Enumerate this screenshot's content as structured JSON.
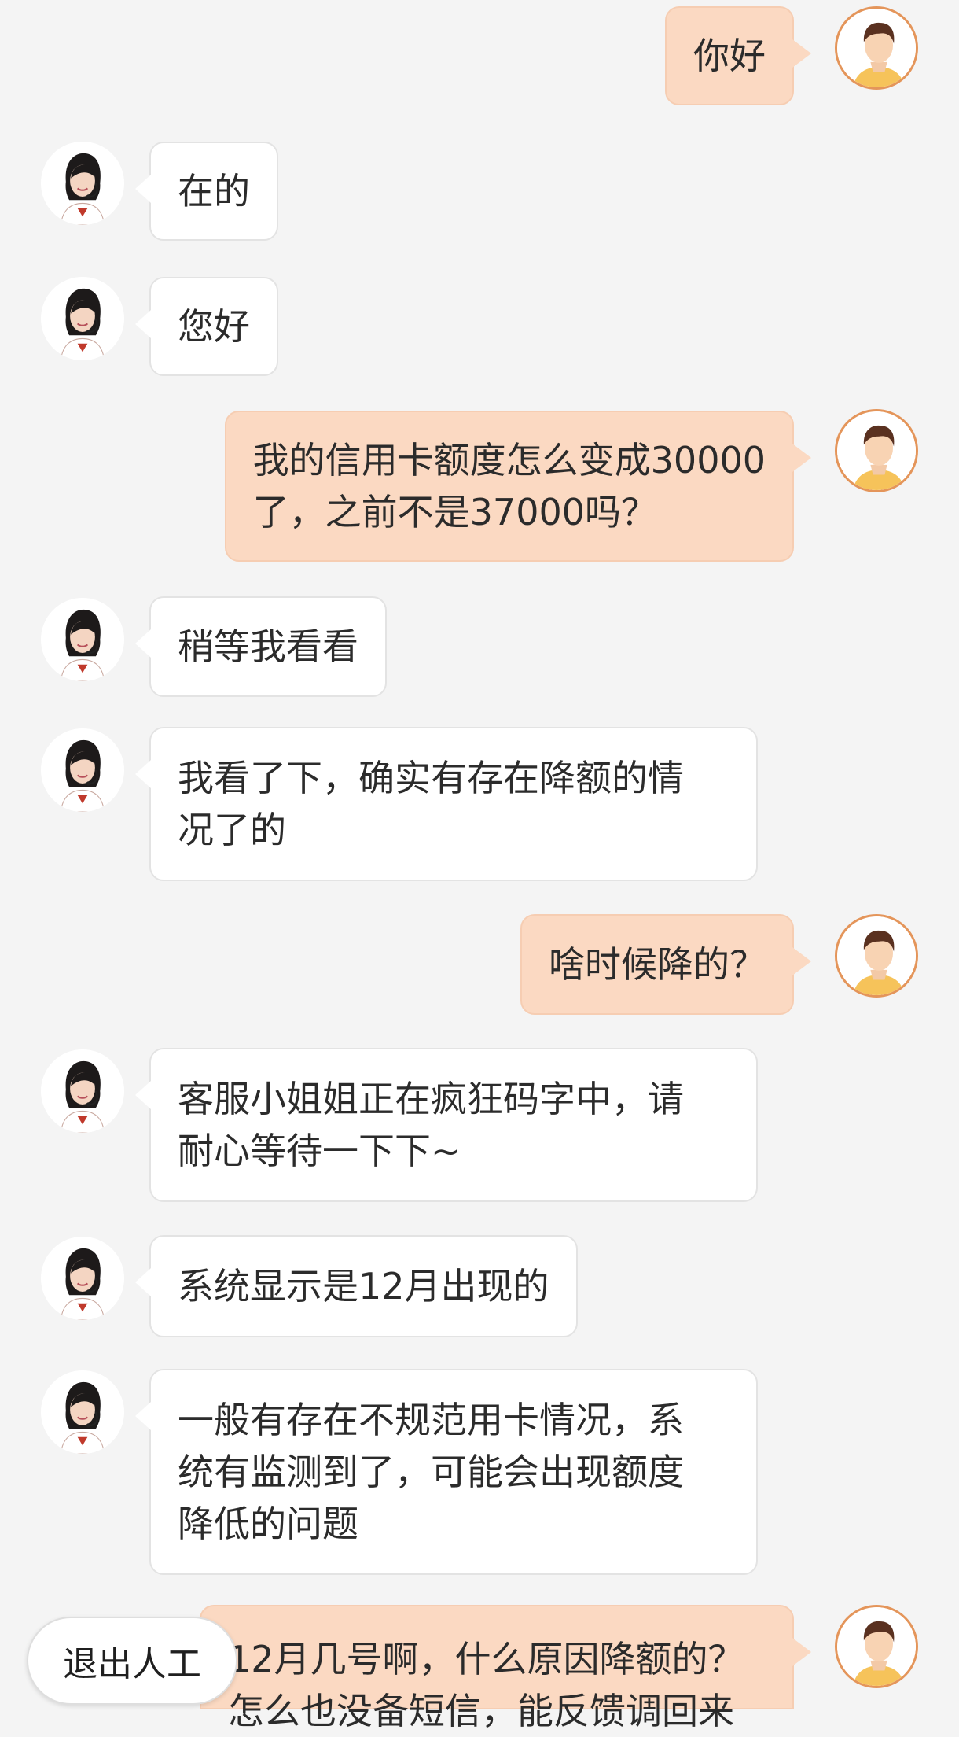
{
  "messages": [
    {
      "role": "user",
      "text": "你好"
    },
    {
      "role": "agent",
      "text": "在的"
    },
    {
      "role": "agent",
      "text": "您好"
    },
    {
      "role": "user",
      "text": "我的信用卡额度怎么变成30000\n了，之前不是37000吗？"
    },
    {
      "role": "agent",
      "text": "稍等我看看"
    },
    {
      "role": "agent",
      "text": "我看了下，确实有存在降额的情\n况了的"
    },
    {
      "role": "user",
      "text": "啥时候降的？"
    },
    {
      "role": "agent",
      "text": "客服小姐姐正在疯狂码字中，请\n耐心等待一下下~"
    },
    {
      "role": "agent",
      "text": "系统显示是12月出现的"
    },
    {
      "role": "agent",
      "text": "一般有存在不规范用卡情况，系\n统有监测到了，可能会出现额度\n降低的问题"
    },
    {
      "role": "user",
      "text": "12月几号啊，什么原因降额的？\n怎么也没备短信，能反馈调回来"
    }
  ],
  "exit_button": {
    "label": "退出人工"
  },
  "colors": {
    "background": "#f4f4f4",
    "user_bubble": "#fbd9c2",
    "agent_bubble": "#ffffff",
    "avatar_ring": "#e4955a"
  },
  "icons": {
    "agent_avatar": "customer-service-agent-avatar",
    "user_avatar": "user-avatar"
  }
}
